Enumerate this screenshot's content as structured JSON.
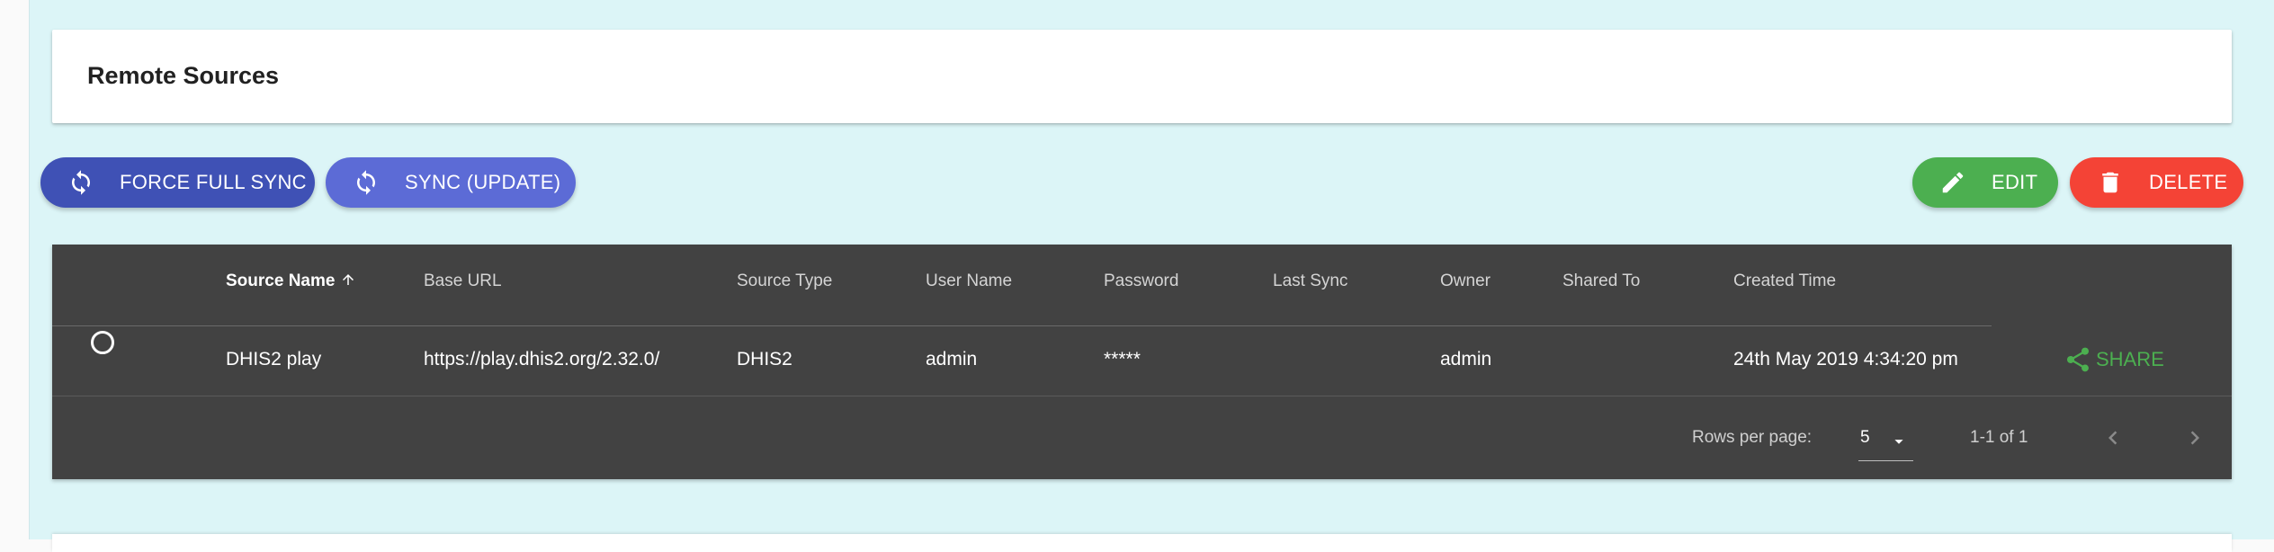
{
  "page": {
    "title": "Remote Sources"
  },
  "toolbar": {
    "force_full_sync_label": "FORCE FULL SYNC",
    "sync_update_label": "SYNC (UPDATE)",
    "edit_label": "EDIT",
    "delete_label": "DELETE"
  },
  "table": {
    "columns": [
      "Source Name",
      "Base URL",
      "Source Type",
      "User Name",
      "Password",
      "Last Sync",
      "Owner",
      "Shared To",
      "Created Time"
    ],
    "sorted_column": "Source Name",
    "sort_direction": "ascending",
    "rows": [
      {
        "selected": false,
        "source_name": "DHIS2 play",
        "base_url": "https://play.dhis2.org/2.32.0/",
        "source_type": "DHIS2",
        "user_name": "admin",
        "password": "*****",
        "last_sync": "",
        "owner": "admin",
        "shared_to": "",
        "created_time": "24th May 2019 4:34:20 pm",
        "share_label": "SHARE"
      }
    ]
  },
  "pagination": {
    "rows_per_page_label": "Rows per page:",
    "rows_per_page_value": "5",
    "range_text": "1-1 of 1"
  },
  "colors": {
    "background": "#dcf5f7",
    "primary_button": "#3f51b5",
    "secondary_button": "#5c6bd6",
    "edit_button": "#4caf50",
    "delete_button": "#f44336",
    "table_background": "#424242",
    "share_text": "#4caf50"
  },
  "icons": {
    "force_full_sync": "sync-icon",
    "sync_update": "sync-icon",
    "edit": "pencil-icon",
    "delete": "trash-icon",
    "sort": "arrow-up-icon",
    "share": "share-icon",
    "rows_select": "caret-down-icon",
    "prev_page": "chevron-left-icon",
    "next_page": "chevron-right-icon"
  }
}
